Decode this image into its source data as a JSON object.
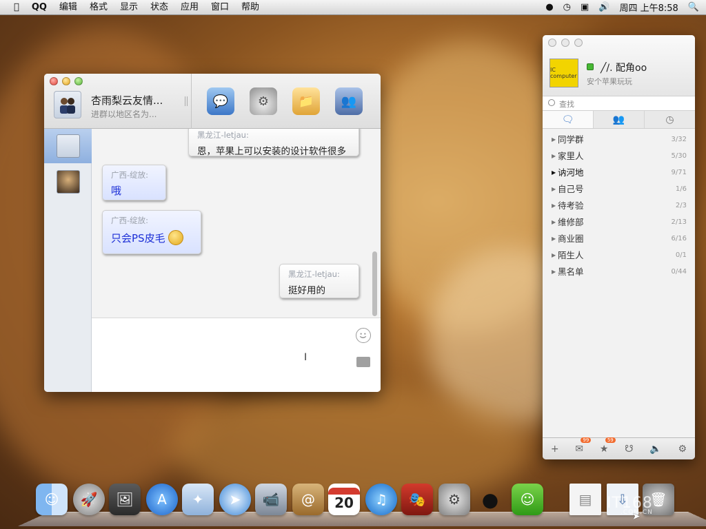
{
  "menubar": {
    "app": "QQ",
    "items": [
      "编辑",
      "格式",
      "显示",
      "状态",
      "应用",
      "窗口",
      "帮助"
    ],
    "clock": "周四 上午8:58"
  },
  "chat": {
    "group_name": "杏雨梨云友情...",
    "group_sub": "进群以地区名为...",
    "messages": [
      {
        "sender": "黑龙江-letjau:",
        "text": "恩，苹果上可以安装的设计软件很多",
        "dir": "out"
      },
      {
        "sender": "广西-绽放:",
        "text": "哦",
        "dir": "in"
      },
      {
        "sender": "广西-绽放:",
        "text": "只会PS皮毛",
        "dir": "in"
      },
      {
        "sender": "黑龙江-letjau:",
        "text": "挺好用的",
        "dir": "out"
      }
    ]
  },
  "panel": {
    "nickname": "╱/. 配角oo",
    "signature": "安个苹果玩玩",
    "search_placeholder": "查找",
    "avatar_text": "IC computer",
    "groups": [
      {
        "name": "同学群",
        "count": "3/32"
      },
      {
        "name": "家里人",
        "count": "5/30"
      },
      {
        "name": "讷河地",
        "count": "9/71"
      },
      {
        "name": "自己号",
        "count": "1/6"
      },
      {
        "name": "待考验",
        "count": "2/3"
      },
      {
        "name": "维修部",
        "count": "2/13"
      },
      {
        "name": "商业圈",
        "count": "6/16"
      },
      {
        "name": "陌生人",
        "count": "0/1"
      },
      {
        "name": "黑名单",
        "count": "0/44"
      }
    ],
    "badges": {
      "mail": "99",
      "star": "59"
    }
  },
  "dock": {
    "calendar_day": "20"
  },
  "watermark": {
    "main": "IT168",
    "sub": ".COM.CN"
  },
  "colors": {
    "accent": "#3b77c6",
    "status_online": "#47b834",
    "badge": "#f26b2e"
  }
}
